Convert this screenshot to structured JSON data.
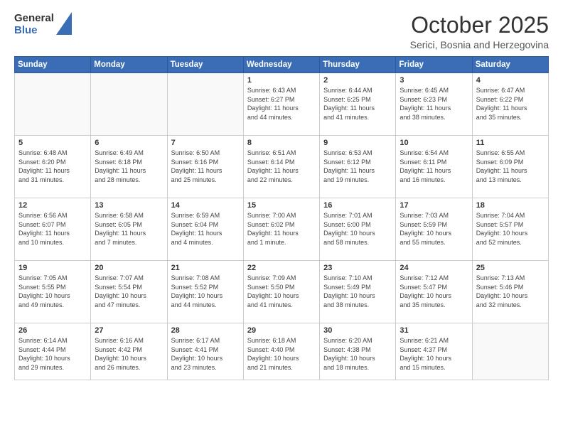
{
  "header": {
    "logo": {
      "line1": "General",
      "line2": "Blue"
    },
    "title": "October 2025",
    "subtitle": "Serici, Bosnia and Herzegovina"
  },
  "weekdays": [
    "Sunday",
    "Monday",
    "Tuesday",
    "Wednesday",
    "Thursday",
    "Friday",
    "Saturday"
  ],
  "rows": [
    [
      {
        "day": "",
        "info": ""
      },
      {
        "day": "",
        "info": ""
      },
      {
        "day": "",
        "info": ""
      },
      {
        "day": "1",
        "info": "Sunrise: 6:43 AM\nSunset: 6:27 PM\nDaylight: 11 hours\nand 44 minutes."
      },
      {
        "day": "2",
        "info": "Sunrise: 6:44 AM\nSunset: 6:25 PM\nDaylight: 11 hours\nand 41 minutes."
      },
      {
        "day": "3",
        "info": "Sunrise: 6:45 AM\nSunset: 6:23 PM\nDaylight: 11 hours\nand 38 minutes."
      },
      {
        "day": "4",
        "info": "Sunrise: 6:47 AM\nSunset: 6:22 PM\nDaylight: 11 hours\nand 35 minutes."
      }
    ],
    [
      {
        "day": "5",
        "info": "Sunrise: 6:48 AM\nSunset: 6:20 PM\nDaylight: 11 hours\nand 31 minutes."
      },
      {
        "day": "6",
        "info": "Sunrise: 6:49 AM\nSunset: 6:18 PM\nDaylight: 11 hours\nand 28 minutes."
      },
      {
        "day": "7",
        "info": "Sunrise: 6:50 AM\nSunset: 6:16 PM\nDaylight: 11 hours\nand 25 minutes."
      },
      {
        "day": "8",
        "info": "Sunrise: 6:51 AM\nSunset: 6:14 PM\nDaylight: 11 hours\nand 22 minutes."
      },
      {
        "day": "9",
        "info": "Sunrise: 6:53 AM\nSunset: 6:12 PM\nDaylight: 11 hours\nand 19 minutes."
      },
      {
        "day": "10",
        "info": "Sunrise: 6:54 AM\nSunset: 6:11 PM\nDaylight: 11 hours\nand 16 minutes."
      },
      {
        "day": "11",
        "info": "Sunrise: 6:55 AM\nSunset: 6:09 PM\nDaylight: 11 hours\nand 13 minutes."
      }
    ],
    [
      {
        "day": "12",
        "info": "Sunrise: 6:56 AM\nSunset: 6:07 PM\nDaylight: 11 hours\nand 10 minutes."
      },
      {
        "day": "13",
        "info": "Sunrise: 6:58 AM\nSunset: 6:05 PM\nDaylight: 11 hours\nand 7 minutes."
      },
      {
        "day": "14",
        "info": "Sunrise: 6:59 AM\nSunset: 6:04 PM\nDaylight: 11 hours\nand 4 minutes."
      },
      {
        "day": "15",
        "info": "Sunrise: 7:00 AM\nSunset: 6:02 PM\nDaylight: 11 hours\nand 1 minute."
      },
      {
        "day": "16",
        "info": "Sunrise: 7:01 AM\nSunset: 6:00 PM\nDaylight: 10 hours\nand 58 minutes."
      },
      {
        "day": "17",
        "info": "Sunrise: 7:03 AM\nSunset: 5:59 PM\nDaylight: 10 hours\nand 55 minutes."
      },
      {
        "day": "18",
        "info": "Sunrise: 7:04 AM\nSunset: 5:57 PM\nDaylight: 10 hours\nand 52 minutes."
      }
    ],
    [
      {
        "day": "19",
        "info": "Sunrise: 7:05 AM\nSunset: 5:55 PM\nDaylight: 10 hours\nand 49 minutes."
      },
      {
        "day": "20",
        "info": "Sunrise: 7:07 AM\nSunset: 5:54 PM\nDaylight: 10 hours\nand 47 minutes."
      },
      {
        "day": "21",
        "info": "Sunrise: 7:08 AM\nSunset: 5:52 PM\nDaylight: 10 hours\nand 44 minutes."
      },
      {
        "day": "22",
        "info": "Sunrise: 7:09 AM\nSunset: 5:50 PM\nDaylight: 10 hours\nand 41 minutes."
      },
      {
        "day": "23",
        "info": "Sunrise: 7:10 AM\nSunset: 5:49 PM\nDaylight: 10 hours\nand 38 minutes."
      },
      {
        "day": "24",
        "info": "Sunrise: 7:12 AM\nSunset: 5:47 PM\nDaylight: 10 hours\nand 35 minutes."
      },
      {
        "day": "25",
        "info": "Sunrise: 7:13 AM\nSunset: 5:46 PM\nDaylight: 10 hours\nand 32 minutes."
      }
    ],
    [
      {
        "day": "26",
        "info": "Sunrise: 6:14 AM\nSunset: 4:44 PM\nDaylight: 10 hours\nand 29 minutes."
      },
      {
        "day": "27",
        "info": "Sunrise: 6:16 AM\nSunset: 4:42 PM\nDaylight: 10 hours\nand 26 minutes."
      },
      {
        "day": "28",
        "info": "Sunrise: 6:17 AM\nSunset: 4:41 PM\nDaylight: 10 hours\nand 23 minutes."
      },
      {
        "day": "29",
        "info": "Sunrise: 6:18 AM\nSunset: 4:40 PM\nDaylight: 10 hours\nand 21 minutes."
      },
      {
        "day": "30",
        "info": "Sunrise: 6:20 AM\nSunset: 4:38 PM\nDaylight: 10 hours\nand 18 minutes."
      },
      {
        "day": "31",
        "info": "Sunrise: 6:21 AM\nSunset: 4:37 PM\nDaylight: 10 hours\nand 15 minutes."
      },
      {
        "day": "",
        "info": ""
      }
    ]
  ]
}
